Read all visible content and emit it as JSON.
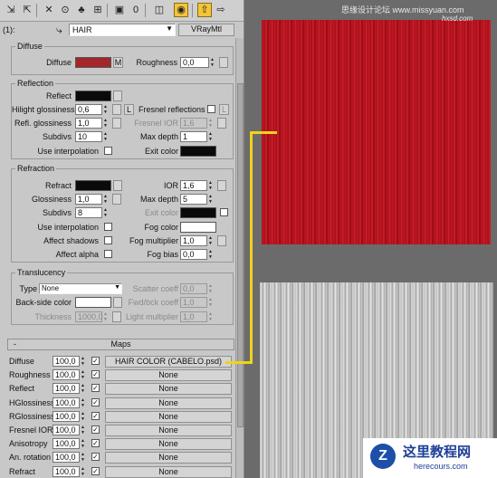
{
  "material": {
    "index_label": "(1):",
    "name": "HAIR",
    "type": "VRayMtl"
  },
  "toolbar": {
    "icons": [
      "get-material-icon",
      "put-to-scene-icon",
      "assign-icon",
      "reset-icon",
      "make-copy-icon",
      "unique-icon",
      "put-to-library-icon",
      "effects-channel-icon",
      "show-map-icon",
      "show-end-result-icon",
      "go-to-parent-icon",
      "go-forward-icon"
    ]
  },
  "diffuse": {
    "group_title": "Diffuse",
    "diffuse_label": "Diffuse",
    "diffuse_color": "#a3262a",
    "map_btn": "M",
    "roughness_label": "Roughness",
    "roughness": "0,0"
  },
  "reflection": {
    "group_title": "Reflection",
    "reflect_label": "Reflect",
    "reflect_color": "#0a0a0a",
    "hilight_label": "Hilight glossiness",
    "hilight": "0,6",
    "lock_btn": "L",
    "fresnel_label": "Fresnel reflections",
    "refl_gloss_label": "Refl. glossiness",
    "refl_gloss": "1,0",
    "fresnel_ior_label": "Fresnel IOR",
    "fresnel_ior": "1,6",
    "subdivs_label": "Subdivs",
    "subdivs": "10",
    "max_depth_label": "Max depth",
    "max_depth": "1",
    "use_interp_label": "Use interpolation",
    "exit_color_label": "Exit color",
    "exit_color": "#0a0a0a"
  },
  "refraction": {
    "group_title": "Refraction",
    "refract_label": "Refract",
    "refract_color": "#0a0a0a",
    "ior_label": "IOR",
    "ior": "1,6",
    "glossiness_label": "Glossiness",
    "glossiness": "1,0",
    "max_depth_label": "Max depth",
    "max_depth": "5",
    "subdivs_label": "Subdivs",
    "subdivs": "8",
    "exit_color_label": "Exit color",
    "exit_color": "#0a0a0a",
    "use_interp_label": "Use interpolation",
    "fog_color_label": "Fog color",
    "fog_color": "#ffffff",
    "affect_shadows_label": "Affect shadows",
    "fog_mult_label": "Fog multiplier",
    "fog_mult": "1,0",
    "affect_alpha_label": "Affect alpha",
    "fog_bias_label": "Fog bias",
    "fog_bias": "0,0"
  },
  "translucency": {
    "group_title": "Translucency",
    "type_label": "Type",
    "type_value": "None",
    "scatter_label": "Scatter coeff",
    "scatter": "0,0",
    "backside_label": "Back-side color",
    "backside_color": "#ffffff",
    "fwd_bck_label": "Fwd/bck coeff",
    "fwd_bck": "1,0",
    "thickness_label": "Thickness",
    "thickness": "1000,0",
    "light_mult_label": "Light multiplier",
    "light_mult": "1,0"
  },
  "maps": {
    "rollout_sign": "-",
    "title": "Maps",
    "rows": [
      {
        "label": "Diffuse",
        "amount": "100,0",
        "checked": "✓",
        "map": "HAIR COLOR (CABELO.psd)"
      },
      {
        "label": "Roughness",
        "amount": "100,0",
        "checked": "✓",
        "map": "None"
      },
      {
        "label": "Reflect",
        "amount": "100,0",
        "checked": "✓",
        "map": "None"
      },
      {
        "label": "HGlossiness",
        "amount": "100,0",
        "checked": "✓",
        "map": "None"
      },
      {
        "label": "RGlossiness",
        "amount": "100,0",
        "checked": "✓",
        "map": "None"
      },
      {
        "label": "Fresnel IOR",
        "amount": "100,0",
        "checked": "✓",
        "map": "None"
      },
      {
        "label": "Anisotropy",
        "amount": "100,0",
        "checked": "✓",
        "map": "None"
      },
      {
        "label": "An. rotation",
        "amount": "100,0",
        "checked": "✓",
        "map": "None"
      },
      {
        "label": "Refract",
        "amount": "100,0",
        "checked": "✓",
        "map": "None"
      }
    ]
  },
  "watermarks": {
    "top": "思缘设计论坛 www.missyuan.com",
    "top_sub": "hxsd.com",
    "bottom_logo": "Z",
    "bottom_text": "这里教程网",
    "bottom_url": "herecours.com"
  }
}
